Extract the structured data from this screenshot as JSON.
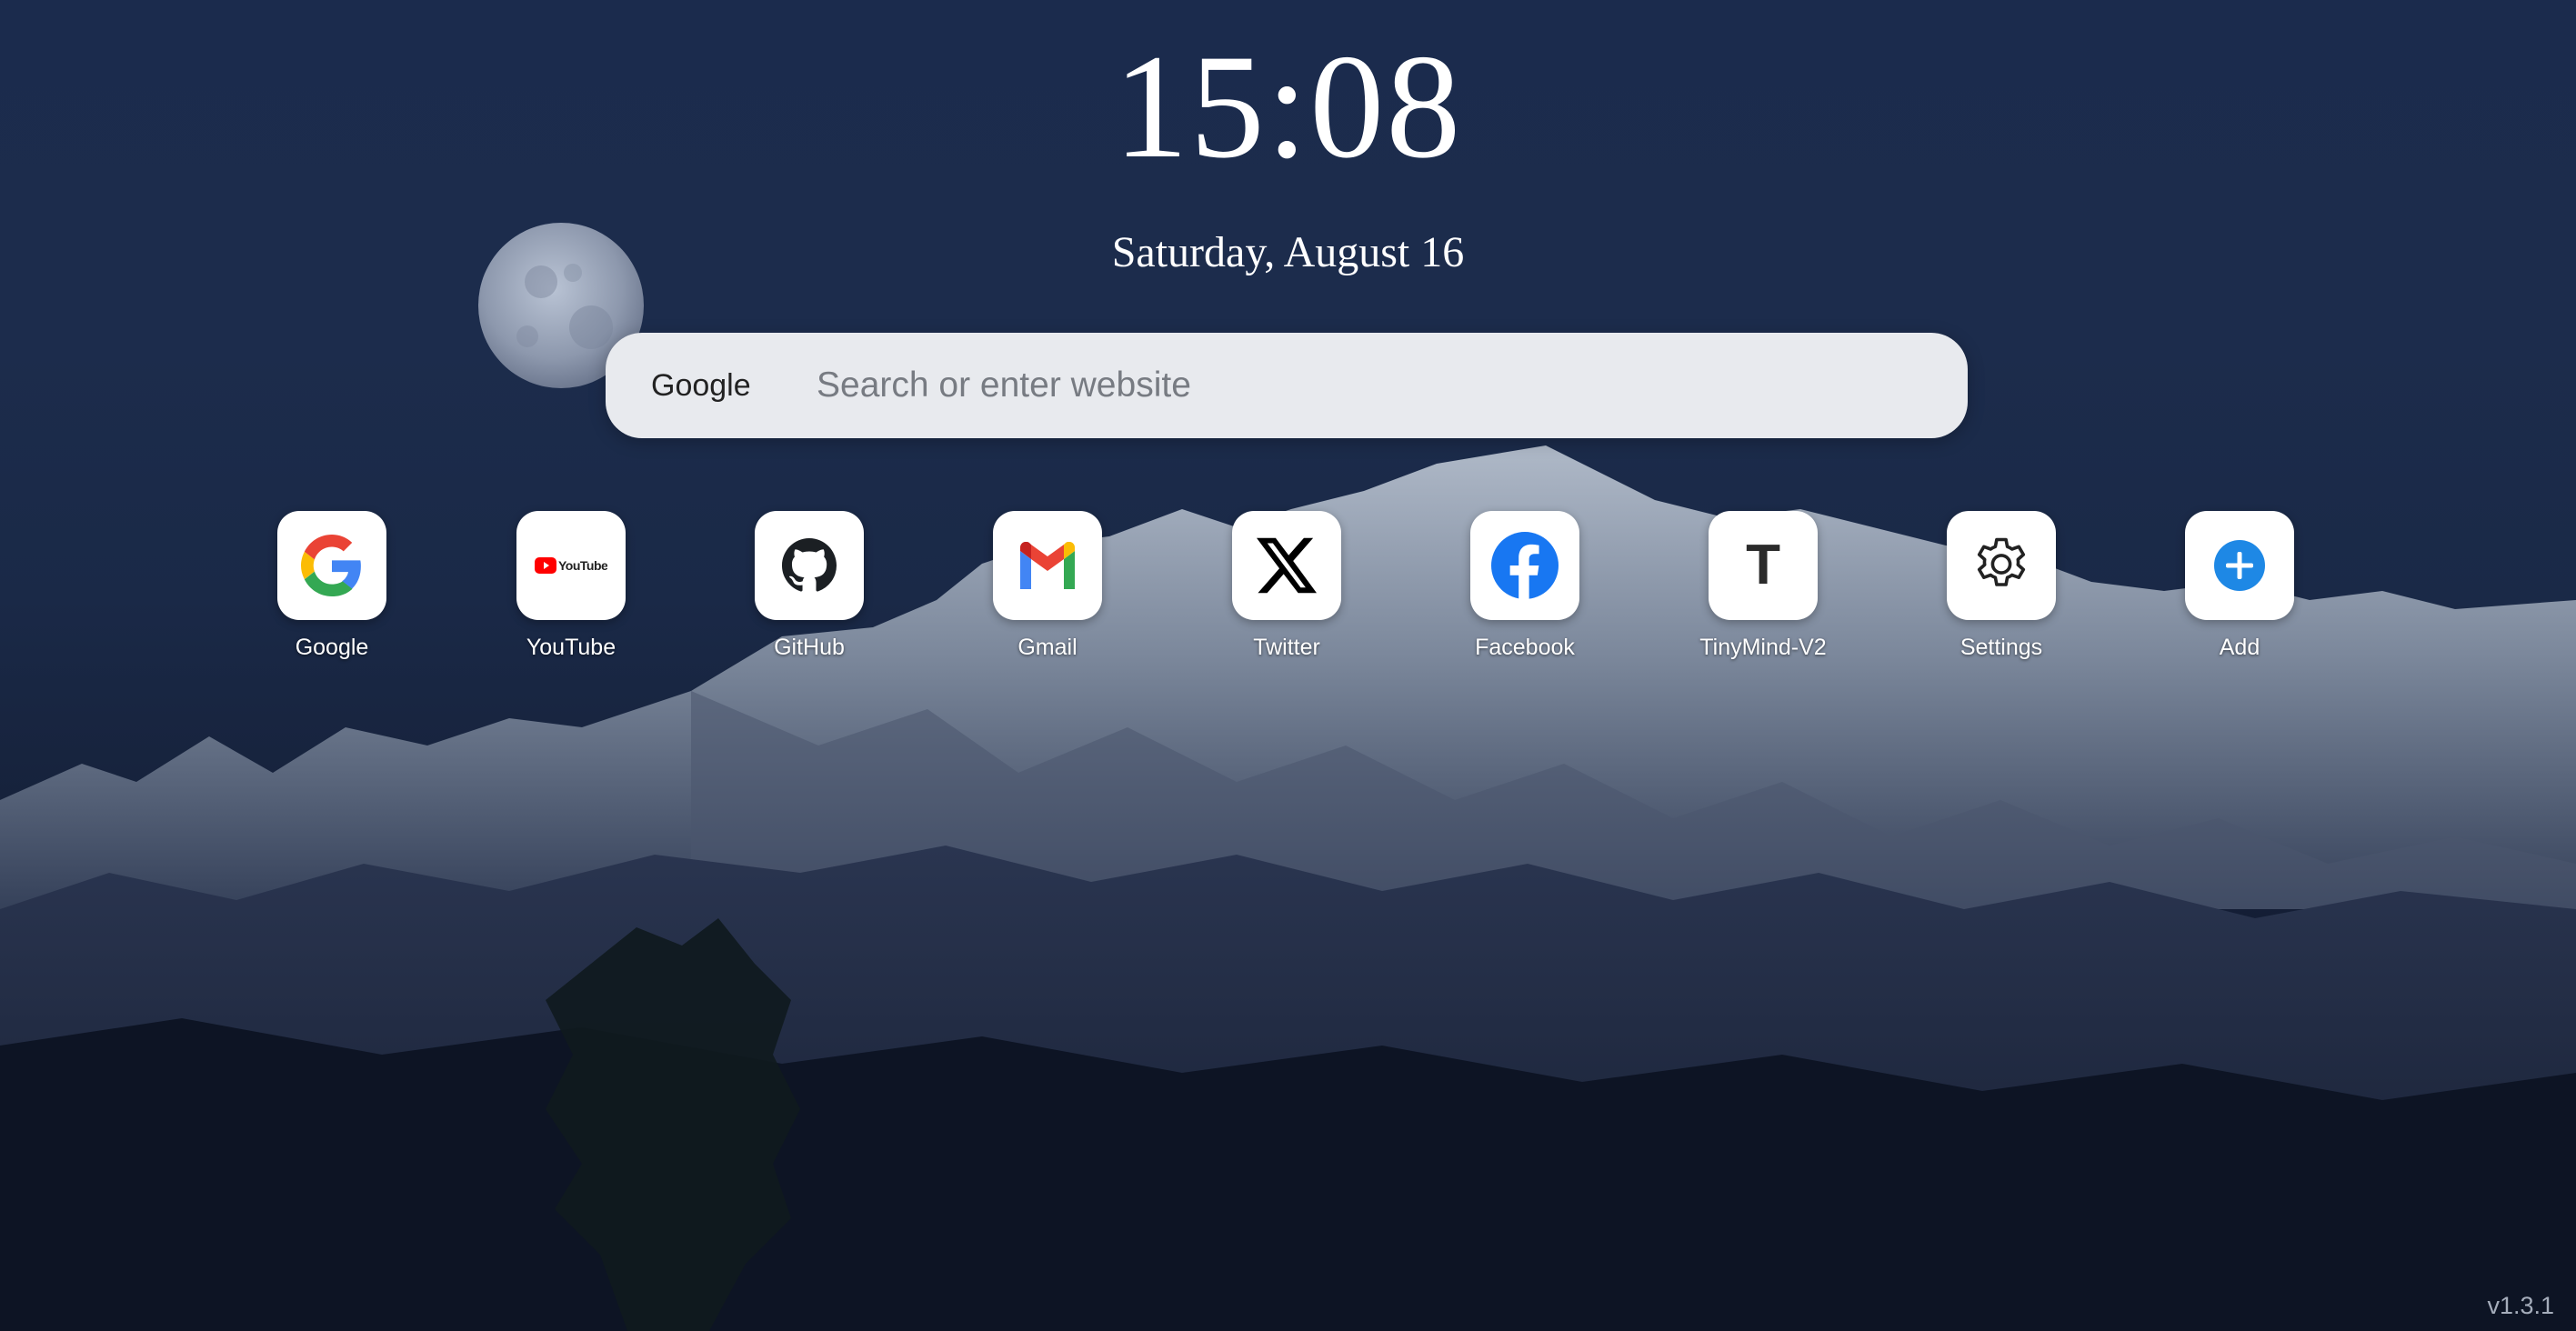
{
  "clock": {
    "time": "15:08"
  },
  "date": {
    "text": "Saturday, August 16"
  },
  "search": {
    "engine": "Google",
    "placeholder": "Search or enter website"
  },
  "shortcuts": [
    {
      "label": "Google",
      "icon": "google-icon"
    },
    {
      "label": "YouTube",
      "icon": "youtube-icon",
      "icon_text": "YouTube"
    },
    {
      "label": "GitHub",
      "icon": "github-icon"
    },
    {
      "label": "Gmail",
      "icon": "gmail-icon"
    },
    {
      "label": "Twitter",
      "icon": "x-icon"
    },
    {
      "label": "Facebook",
      "icon": "facebook-icon"
    },
    {
      "label": "TinyMind-V2",
      "icon": "letter-t-icon",
      "icon_text": "T"
    },
    {
      "label": "Settings",
      "icon": "gear-icon"
    },
    {
      "label": "Add",
      "icon": "plus-icon"
    }
  ],
  "version": "v1.3.1",
  "colors": {
    "sky": "#1b2b4d",
    "search_bg": "#e8eaee",
    "facebook_blue": "#1877f2",
    "add_blue": "#1e88e5",
    "youtube_red": "#ff0000"
  }
}
